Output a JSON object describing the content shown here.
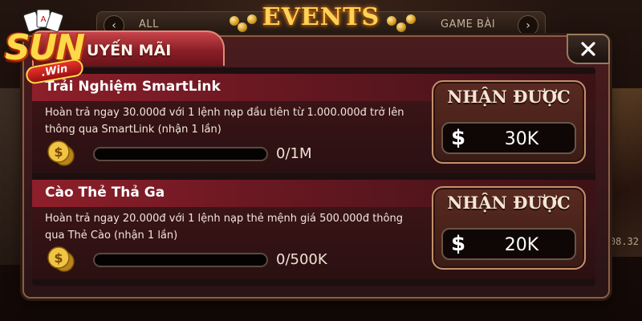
{
  "logo": {
    "brand": "SUN",
    "sub": ".Win"
  },
  "topnav": {
    "left_tab": "ALL",
    "title": "EVENTS",
    "right_tab": "GAME BÀI"
  },
  "panel": {
    "tab_label": "UYẾN MÃI"
  },
  "events": [
    {
      "title": "Trải Nghiệm SmartLink",
      "description": "Hoàn trả ngay 30.000đ với 1 lệnh nạp đầu tiên từ 1.000.000đ trở lên thông qua SmartLink (nhận 1 lần)",
      "progress_text": "0/1M",
      "progress_fraction": 0,
      "reward_label": "NHẬN ĐƯỢC",
      "reward_currency": "$",
      "reward_value": "30K"
    },
    {
      "title": "Cào Thẻ Thả Ga",
      "description": "Hoàn trả ngay 20.000đ với 1 lệnh nạp thẻ mệnh giá 500.000đ thông qua Thẻ Cào (nhận 1 lần)",
      "progress_text": "0/500K",
      "progress_fraction": 0,
      "reward_label": "NHẬN ĐƯỢC",
      "reward_currency": "$",
      "reward_value": "20K"
    }
  ],
  "background": {
    "right_number": "08.32"
  },
  "colors": {
    "accent_gold": "#ffd25a",
    "row_header": "#8e1f2a",
    "panel_border": "#8a5e46"
  }
}
